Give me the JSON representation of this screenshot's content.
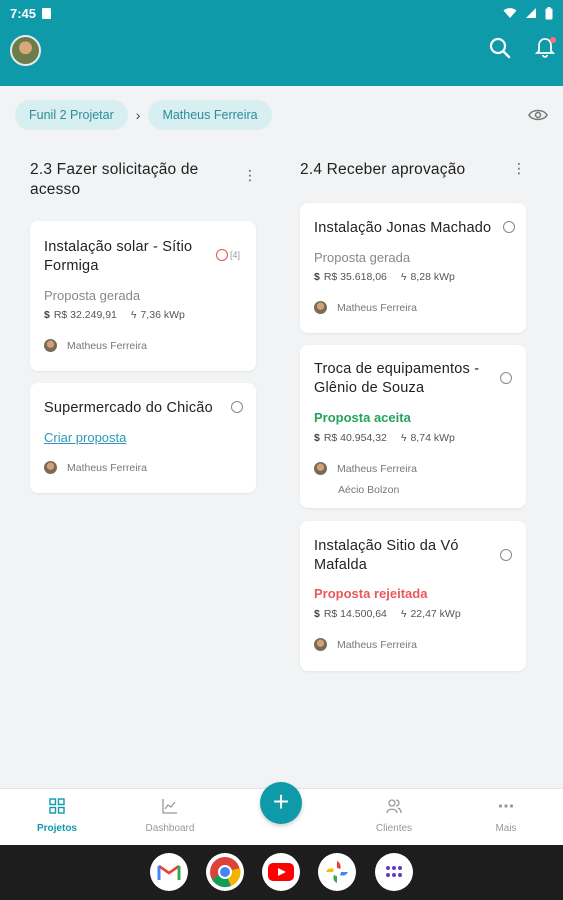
{
  "status_bar": {
    "time": "7:45"
  },
  "breadcrumbs": [
    "Funil 2 Projetar",
    "Matheus Ferreira"
  ],
  "columns": [
    {
      "title": "2.3 Fazer solicitação de acesso",
      "cards": [
        {
          "title": "Instalação solar - Sítio Formiga",
          "count": "[4]",
          "status": "Proposta gerada",
          "value": "R$ 32.249,91",
          "power": "7,36 kWp",
          "people": [
            "Matheus Ferreira"
          ]
        },
        {
          "title": "Supermercado do Chicão",
          "action_link": "Criar proposta",
          "people": [
            "Matheus Ferreira"
          ]
        }
      ]
    },
    {
      "title": "2.4 Receber aprovação",
      "cards": [
        {
          "title": "Instalação Jonas Machado",
          "status": "Proposta gerada",
          "value": "R$ 35.618,06",
          "power": "8,28 kWp",
          "people": [
            "Matheus Ferreira"
          ]
        },
        {
          "title": "Troca de equipamentos - Glênio de Souza",
          "status": "Proposta aceita",
          "value": "R$ 40.954,32",
          "power": "8,74 kWp",
          "people": [
            "Matheus Ferreira",
            "Aécio Bolzon"
          ]
        },
        {
          "title": "Instalação Sitio da Vó Mafalda",
          "status": "Proposta rejeitada",
          "value": "R$ 14.500,64",
          "power": "22,47 kWp",
          "people": [
            "Matheus Ferreira"
          ]
        }
      ]
    }
  ],
  "bottom_nav": [
    {
      "label": "Projetos",
      "icon": "grid-icon",
      "active": true
    },
    {
      "label": "Dashboard",
      "icon": "chart-icon"
    },
    {
      "label": "Clientes",
      "icon": "people-icon"
    },
    {
      "label": "Mais",
      "icon": "more-icon"
    }
  ],
  "fab_label": "+",
  "colors": {
    "brand": "#0f9aaa",
    "accepted": "#23a35b",
    "rejected": "#e8585e",
    "link": "#2f98b8"
  }
}
